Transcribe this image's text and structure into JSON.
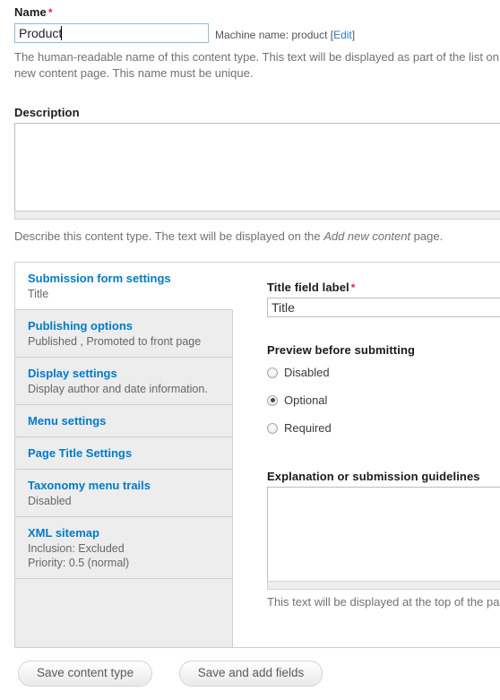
{
  "name_field": {
    "label": "Name",
    "required_marker": "*",
    "value": "Product",
    "machine_name_prefix": "Machine name: product [",
    "machine_name_edit": "Edit",
    "machine_name_suffix": "]",
    "help": "The human-readable name of this content type. This text will be displayed as part of the list on the Add new content page. This name must be unique.",
    "help_emphasis": "Add new content"
  },
  "description_field": {
    "label": "Description",
    "value": "",
    "help_before": "Describe this content type. The text will be displayed on the ",
    "help_emphasis": "Add new content",
    "help_after": " page."
  },
  "vertical_tabs": [
    {
      "title": "Submission form settings",
      "summary": "Title",
      "selected": true
    },
    {
      "title": "Publishing options",
      "summary": "Published , Promoted to front page",
      "selected": false
    },
    {
      "title": "Display settings",
      "summary": "Display author and date information.",
      "selected": false
    },
    {
      "title": "Menu settings",
      "summary": "",
      "selected": false
    },
    {
      "title": "Page Title Settings",
      "summary": "",
      "selected": false
    },
    {
      "title": "Taxonomy menu trails",
      "summary": "Disabled",
      "selected": false
    },
    {
      "title": "XML sitemap",
      "summary": "Inclusion: Excluded\nPriority: 0.5 (normal)",
      "selected": false
    }
  ],
  "panel": {
    "title_field": {
      "label": "Title field label",
      "required_marker": "*",
      "value": "Title"
    },
    "preview": {
      "label": "Preview before submitting",
      "options": [
        {
          "label": "Disabled",
          "checked": false
        },
        {
          "label": "Optional",
          "checked": true
        },
        {
          "label": "Required",
          "checked": false
        }
      ]
    },
    "explanation": {
      "label": "Explanation or submission guidelines",
      "value": "",
      "help": "This text will be displayed at the top of the page"
    }
  },
  "actions": {
    "save_content_type": "Save content type",
    "save_and_add_fields": "Save and add fields"
  },
  "colors": {
    "link_blue": "#007bc6",
    "required_red": "#e02443",
    "help_gray": "#6d7278",
    "tab_bg": "#ededed",
    "border": "#cfcfcf"
  }
}
